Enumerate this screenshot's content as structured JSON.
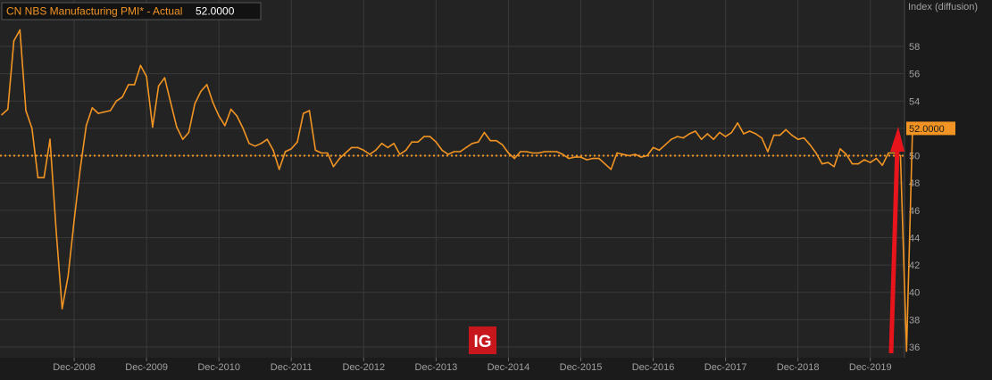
{
  "legend": {
    "label": "CN NBS Manufacturing PMI* - Actual",
    "value": "52.0000"
  },
  "logo": {
    "text": "IG"
  },
  "colors": {
    "background": "#1b1b1b",
    "plot_background": "#232323",
    "line": "#f29423",
    "grid": "#3a3a3a",
    "text": "#a0a0a0",
    "reference_line": "#f29423",
    "arrow": "#e8141b",
    "logo_bg": "#c8161d"
  },
  "chart_data": {
    "type": "line",
    "title": "CN NBS Manufacturing PMI* - Actual",
    "ylabel": "Index (diffusion)",
    "ylim": [
      35.5,
      61
    ],
    "yticks": [
      36,
      38,
      40,
      42,
      44,
      46,
      48,
      50,
      52,
      54,
      56,
      58
    ],
    "x_start": "2007-12",
    "x_end": "2020-03",
    "x_tick_labels": [
      "Dec-2008",
      "Dec-2009",
      "Dec-2010",
      "Dec-2011",
      "Dec-2012",
      "Dec-2013",
      "Dec-2014",
      "Dec-2015",
      "Dec-2016",
      "Dec-2017",
      "Dec-2018",
      "Dec-2019"
    ],
    "reference_value": 50,
    "last_value": "52.0000",
    "annotation": "red arrow pointing up at latest reading",
    "series": [
      {
        "values": [
          53.0,
          53.4,
          58.4,
          59.2,
          53.3,
          52.0,
          48.4,
          48.4,
          51.2,
          44.6,
          38.8,
          41.2,
          45.3,
          49.0,
          52.2,
          53.5,
          53.1,
          53.2,
          53.3,
          54.0,
          54.3,
          55.2,
          55.2,
          56.6,
          55.8,
          52.1,
          55.1,
          55.7,
          53.9,
          52.1,
          51.2,
          51.7,
          53.8,
          54.7,
          55.2,
          53.9,
          52.9,
          52.2,
          53.4,
          52.9,
          52.0,
          50.9,
          50.7,
          50.9,
          51.2,
          50.4,
          49.0,
          50.3,
          50.5,
          51.0,
          53.1,
          53.3,
          50.4,
          50.2,
          50.2,
          49.2,
          49.8,
          50.2,
          50.6,
          50.6,
          50.4,
          50.1,
          50.4,
          50.9,
          50.6,
          50.9,
          50.1,
          50.4,
          51.0,
          51.0,
          51.4,
          51.4,
          51.0,
          50.4,
          50.1,
          50.3,
          50.3,
          50.6,
          50.9,
          51.0,
          51.7,
          51.1,
          51.1,
          50.8,
          50.2,
          49.8,
          50.3,
          50.3,
          50.2,
          50.2,
          50.3,
          50.3,
          50.3,
          50.1,
          49.8,
          49.9,
          49.9,
          49.7,
          49.8,
          49.8,
          49.4,
          49.0,
          50.2,
          50.1,
          50.0,
          50.1,
          49.9,
          50.0,
          50.6,
          50.4,
          50.8,
          51.2,
          51.4,
          51.3,
          51.6,
          51.8,
          51.2,
          51.6,
          51.2,
          51.7,
          51.4,
          51.7,
          52.4,
          51.6,
          51.8,
          51.6,
          51.3,
          50.3,
          51.5,
          51.5,
          51.9,
          51.5,
          51.2,
          51.3,
          50.8,
          50.2,
          49.4,
          49.5,
          49.2,
          50.5,
          50.1,
          49.4,
          49.4,
          49.7,
          49.5,
          49.8,
          49.3,
          50.2,
          50.2,
          50.0,
          35.7,
          52.0
        ]
      }
    ]
  }
}
